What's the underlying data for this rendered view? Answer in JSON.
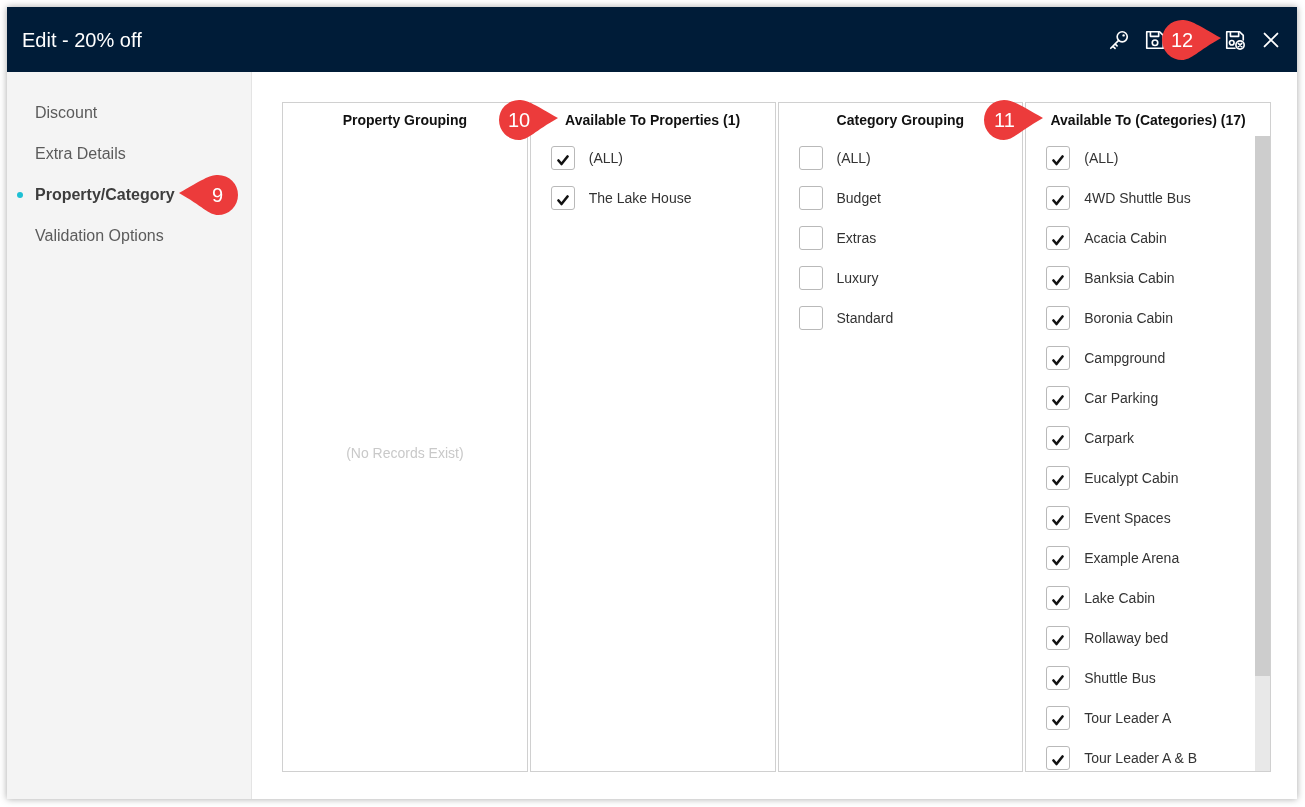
{
  "window": {
    "title": "Edit - 20% off"
  },
  "toolbar": [
    {
      "kind": "key"
    },
    {
      "kind": "save"
    },
    {
      "kind": "save-close",
      "callout": "12"
    },
    {
      "kind": "close"
    }
  ],
  "sidebar": {
    "items": [
      {
        "label": "Discount",
        "selected": false
      },
      {
        "label": "Extra Details",
        "selected": false
      },
      {
        "label": "Property/Category",
        "selected": true,
        "callout": "9"
      },
      {
        "label": "Validation Options",
        "selected": false
      }
    ]
  },
  "columns": [
    {
      "title": "Property Grouping",
      "empty_text": "(No Records Exist)"
    },
    {
      "title": "Available To Properties (1)",
      "callout": "10",
      "items": [
        {
          "label": "(ALL)",
          "checked": true
        },
        {
          "label": "The Lake House",
          "checked": true
        }
      ]
    },
    {
      "title": "Category Grouping",
      "items": [
        {
          "label": "(ALL)",
          "checked": false
        },
        {
          "label": "Budget",
          "checked": false
        },
        {
          "label": "Extras",
          "checked": false
        },
        {
          "label": "Luxury",
          "checked": false
        },
        {
          "label": "Standard",
          "checked": false
        }
      ]
    },
    {
      "title": "Available To (Categories) (17)",
      "callout": "11",
      "items": [
        {
          "label": "(ALL)",
          "checked": true
        },
        {
          "label": "4WD Shuttle Bus",
          "checked": true
        },
        {
          "label": "Acacia Cabin",
          "checked": true
        },
        {
          "label": "Banksia Cabin",
          "checked": true
        },
        {
          "label": "Boronia Cabin",
          "checked": true
        },
        {
          "label": "Campground",
          "checked": true
        },
        {
          "label": "Car Parking",
          "checked": true
        },
        {
          "label": "Carpark",
          "checked": true
        },
        {
          "label": "Eucalypt Cabin",
          "checked": true
        },
        {
          "label": "Event Spaces",
          "checked": true
        },
        {
          "label": "Example Arena",
          "checked": true
        },
        {
          "label": "Lake Cabin",
          "checked": true
        },
        {
          "label": "Rollaway bed",
          "checked": true
        },
        {
          "label": "Shuttle Bus",
          "checked": true
        },
        {
          "label": "Tour Leader A",
          "checked": true
        },
        {
          "label": "Tour Leader A & B",
          "checked": true
        }
      ]
    }
  ]
}
